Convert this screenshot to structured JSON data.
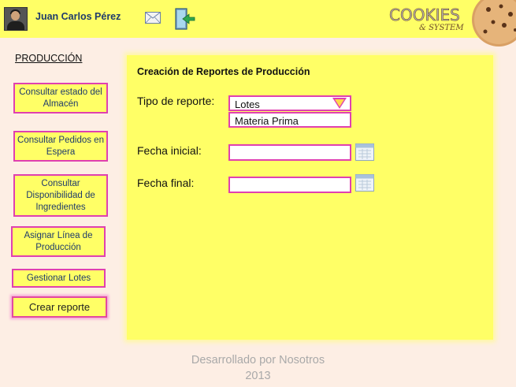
{
  "header": {
    "user_name": "Juan Carlos Pérez",
    "brand_line1": "COOKIES",
    "brand_line2": "& SYSTEM",
    "accent_color": "#ffff66",
    "border_color": "#e040b0"
  },
  "sidebar": {
    "section_title": "PRODUCCIÓN",
    "items": [
      {
        "label": "Consultar estado del Almacén"
      },
      {
        "label": "Consultar Pedidos en Espera"
      },
      {
        "label": "Consultar Disponibilidad de Ingredientes"
      },
      {
        "label": "Asignar Línea de Producción"
      },
      {
        "label": "Gestionar Lotes"
      },
      {
        "label": "Crear reporte"
      }
    ]
  },
  "form": {
    "title": "Creación de Reportes de Producción",
    "report_type_label": "Tipo de reporte:",
    "report_type_value": "Lotes",
    "report_type_options": [
      "Materia Prima"
    ],
    "start_date_label": "Fecha inicial:",
    "start_date_value": "",
    "end_date_label": "Fecha final:",
    "end_date_value": ""
  },
  "footer": {
    "line1": "Desarrollado por Nosotros",
    "line2": "2013"
  }
}
